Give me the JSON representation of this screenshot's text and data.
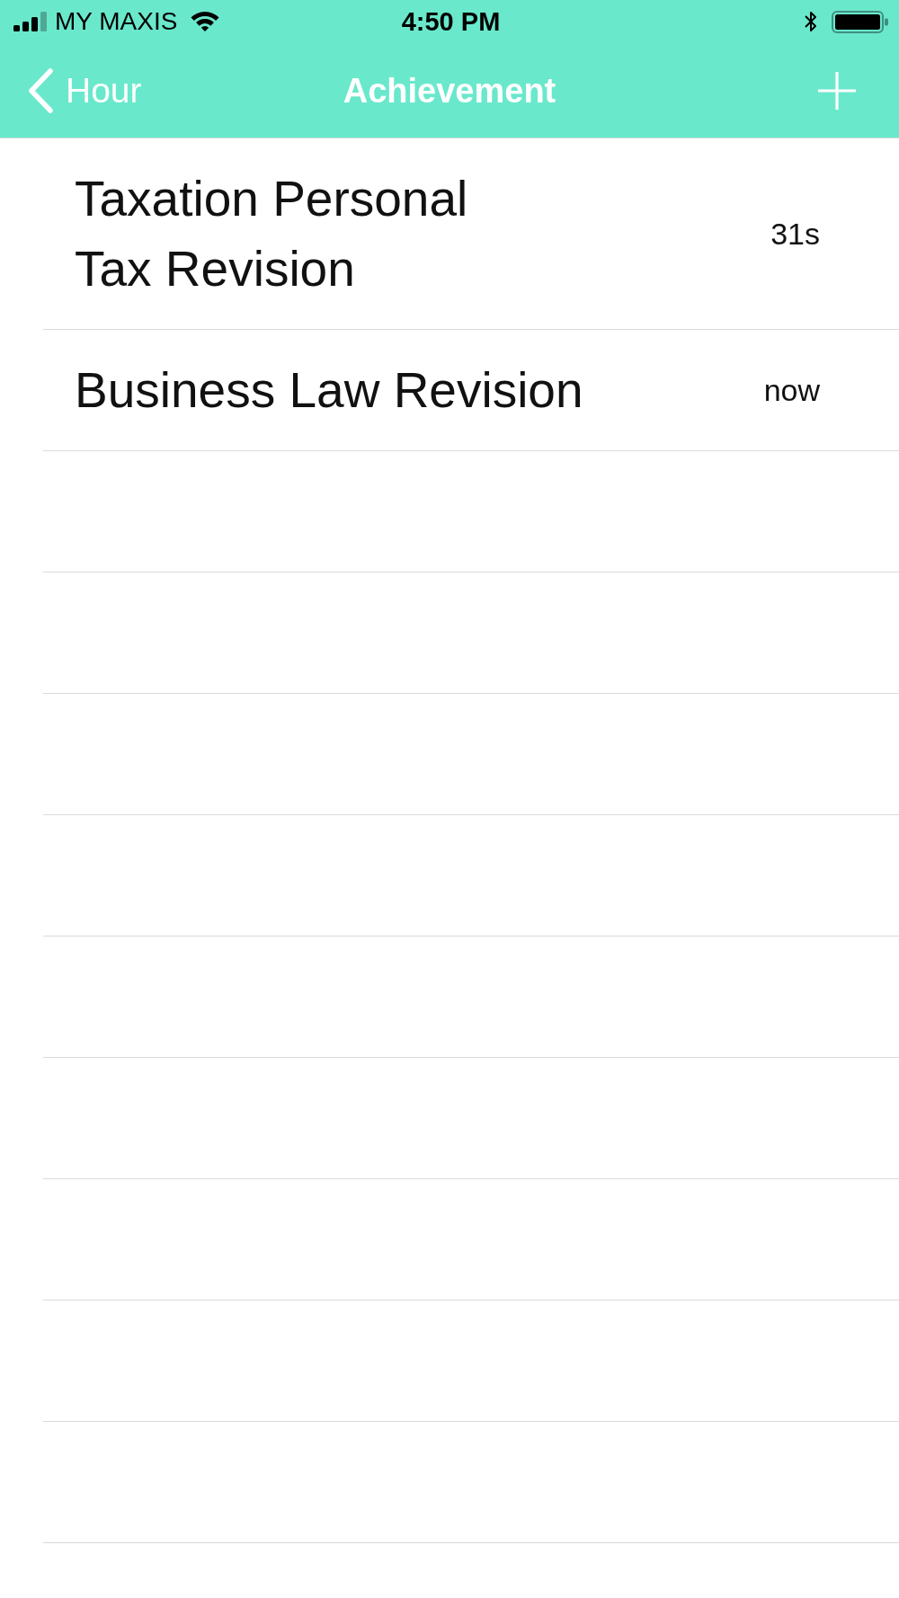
{
  "status_bar": {
    "carrier": "MY MAXIS",
    "time": "4:50 PM"
  },
  "nav_bar": {
    "back_label": "Hour",
    "title": "Achievement"
  },
  "items": [
    {
      "title": "Taxation Personal\nTax Revision",
      "time": "31s"
    },
    {
      "title": "Business Law Revision",
      "time": "now"
    }
  ]
}
